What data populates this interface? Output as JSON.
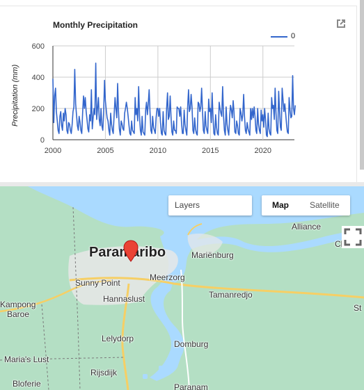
{
  "chart": {
    "title": "Monthly Precipitation",
    "legend_label": "0",
    "ylabel": "Precipitation (mm)",
    "popout_icon": "open-in-new-icon"
  },
  "chart_data": {
    "type": "line",
    "title": "Monthly Precipitation",
    "xlabel": "",
    "ylabel": "Precipitation (mm)",
    "xlim": [
      2000,
      2023
    ],
    "ylim": [
      0,
      600
    ],
    "x_ticks": [
      "2000",
      "2005",
      "2010",
      "2015",
      "2020"
    ],
    "y_ticks": [
      "0",
      "200",
      "400",
      "600"
    ],
    "grid": true,
    "legend_position": "top-right",
    "series": [
      {
        "name": "0",
        "color": "#3366cc",
        "x_start": 2000,
        "step": 0.08333,
        "values": [
          390,
          110,
          280,
          330,
          180,
          120,
          60,
          40,
          150,
          180,
          90,
          60,
          170,
          120,
          200,
          160,
          60,
          40,
          110,
          100,
          60,
          40,
          100,
          180,
          210,
          450,
          230,
          160,
          90,
          60,
          150,
          110,
          60,
          40,
          170,
          280,
          200,
          270,
          180,
          130,
          70,
          50,
          160,
          120,
          320,
          70,
          140,
          200,
          160,
          490,
          130,
          200,
          270,
          130,
          90,
          200,
          90,
          60,
          170,
          380,
          250,
          190,
          140,
          120,
          60,
          30,
          170,
          100,
          60,
          40,
          160,
          270,
          200,
          140,
          360,
          180,
          70,
          30,
          120,
          100,
          70,
          60,
          170,
          200,
          240,
          200,
          150,
          90,
          40,
          30,
          120,
          60,
          50,
          40,
          270,
          160,
          200,
          120,
          340,
          150,
          60,
          30,
          150,
          50,
          40,
          30,
          190,
          240,
          160,
          230,
          320,
          180,
          60,
          40,
          150,
          80,
          60,
          40,
          140,
          200,
          200,
          150,
          200,
          110,
          40,
          30,
          180,
          60,
          40,
          30,
          200,
          300,
          130,
          150,
          280,
          150,
          50,
          30,
          120,
          60,
          60,
          40,
          210,
          200,
          200,
          150,
          210,
          110,
          40,
          40,
          190,
          100,
          60,
          30,
          210,
          320,
          180,
          200,
          290,
          210,
          60,
          40,
          140,
          70,
          40,
          30,
          240,
          230,
          180,
          210,
          330,
          180,
          60,
          40,
          180,
          90,
          60,
          40,
          260,
          180,
          200,
          110,
          300,
          140,
          40,
          30,
          160,
          80,
          40,
          30,
          240,
          200,
          170,
          150,
          340,
          150,
          60,
          30,
          210,
          100,
          60,
          30,
          150,
          220,
          190,
          140,
          250,
          180,
          50,
          40,
          120,
          90,
          40,
          30,
          200,
          170,
          120,
          160,
          290,
          150,
          60,
          40,
          110,
          70,
          50,
          30,
          200,
          130,
          200,
          140,
          210,
          150,
          60,
          40,
          200,
          100,
          60,
          40,
          190,
          120,
          160,
          80,
          200,
          130,
          30,
          20,
          170,
          70,
          40,
          30,
          270,
          200,
          220,
          130,
          330,
          170,
          60,
          40,
          310,
          190,
          80,
          60,
          330,
          260,
          180,
          230,
          170,
          100,
          50,
          40,
          270,
          190,
          140,
          150,
          410,
          200,
          160,
          220
        ]
      }
    ]
  },
  "map": {
    "labels": {
      "paramaribo": "Paramaribo",
      "alliance": "Alliance",
      "marienburg": "Mariënburg",
      "sunny_point": "Sunny Point",
      "meerzorg": "Meerzorg",
      "hannaslust": "Hannaslust",
      "tamanredjo": "Tamanredjo",
      "kampong_baroe_1": "Kampong",
      "kampong_baroe_2": "Baroe",
      "lelydorp": "Lelydorp",
      "domburg": "Domburg",
      "marias_lust": "Maria's Lust",
      "rijsdijk": "Rijsdijk",
      "bloferie": "Bloferie",
      "paranam": "Paranam",
      "edge_c": "Cl",
      "edge_st": "St"
    },
    "layers_label": "Layers",
    "map_type": {
      "map_label": "Map",
      "satellite_label": "Satellite",
      "selected": "Map"
    },
    "marker_icon": "location-pin-icon",
    "fullscreen_icon": "fullscreen-icon",
    "colors": {
      "land": "#b4dfc4",
      "water": "#aadaff",
      "urban": "#e8e8e8",
      "road": "#f6cf65",
      "marker": "#ea4335"
    }
  }
}
